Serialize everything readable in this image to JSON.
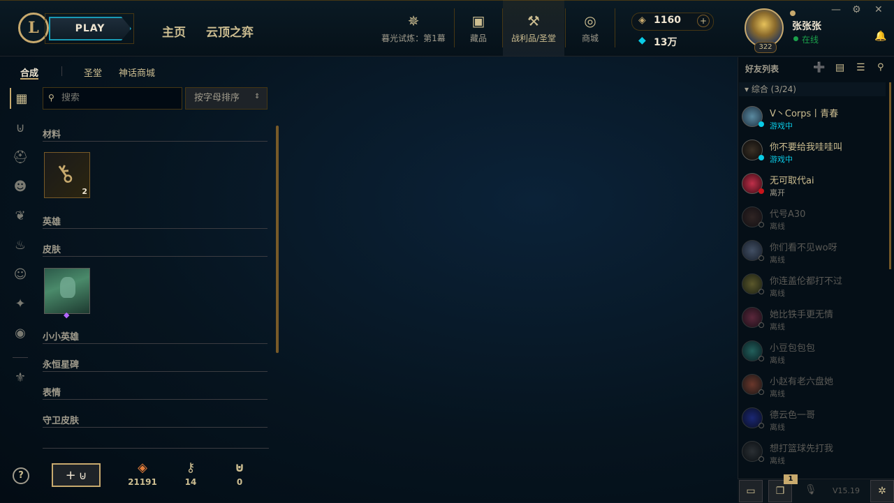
{
  "topbar": {
    "play_label": "PLAY",
    "nav_home": "主页",
    "nav_tft": "云顶之弈",
    "icons": [
      {
        "label": "暮光试炼：第1幕",
        "icon": "event-icon"
      },
      {
        "label": "藏品",
        "icon": "collection-icon"
      },
      {
        "label": "战利品/圣堂",
        "icon": "loot-icon"
      },
      {
        "label": "商城",
        "icon": "store-icon"
      }
    ],
    "rp": "1160",
    "be": "13万",
    "summoner_name": "张张张",
    "status": "在线",
    "level": "322",
    "window_controls": {
      "minimize": "—",
      "close": "✕",
      "settings": "⚙"
    }
  },
  "loot": {
    "tabs": [
      "合成",
      "圣堂",
      "神话商城"
    ],
    "search_placeholder": "搜索",
    "sort_label": "按字母排序",
    "categories": {
      "materials": "材料",
      "champions": "英雄",
      "skins": "皮肤",
      "little_legends": "小小英雄",
      "eternals": "永恒星碑",
      "emotes": "表情",
      "ward_skins": "守卫皮肤"
    },
    "material_item": {
      "icon": "key-fragment-icon",
      "count": "2"
    },
    "skin_item": {
      "icon": "skin-shard-icon"
    }
  },
  "bottom": {
    "craft_icon": "+",
    "orange_essence": "21191",
    "keys": "14",
    "chests": "0"
  },
  "friends": {
    "title": "好友列表",
    "group": "综合 (3/24)",
    "list": [
      {
        "name": "V丶Corps丨青春",
        "status": "游戏中",
        "state": "ingame"
      },
      {
        "name": "你不要给我哇哇叫",
        "status": "游戏中",
        "state": "ingame"
      },
      {
        "name": "无可取代ai",
        "status": "离开",
        "state": "away"
      },
      {
        "name": "代号A30",
        "status": "离线",
        "state": "off"
      },
      {
        "name": "你们看不见wo呀",
        "status": "离线",
        "state": "off"
      },
      {
        "name": "你连盖伦都打不过",
        "status": "离线",
        "state": "off"
      },
      {
        "name": "她比铁手更无情",
        "status": "离线",
        "state": "off"
      },
      {
        "name": "小豆包包包",
        "status": "离线",
        "state": "off"
      },
      {
        "name": "小赵有老六盘她",
        "status": "离线",
        "state": "off"
      },
      {
        "name": "德云色一哥",
        "status": "离线",
        "state": "off"
      },
      {
        "name": "想打篮球先打我",
        "status": "离线",
        "state": "off"
      }
    ],
    "notification_count": "1",
    "version": "V15.19"
  },
  "colors": {
    "gold": "#c8aa6e",
    "cyan": "#0acbe6",
    "online": "#1ba14b",
    "away": "#c8151b"
  }
}
